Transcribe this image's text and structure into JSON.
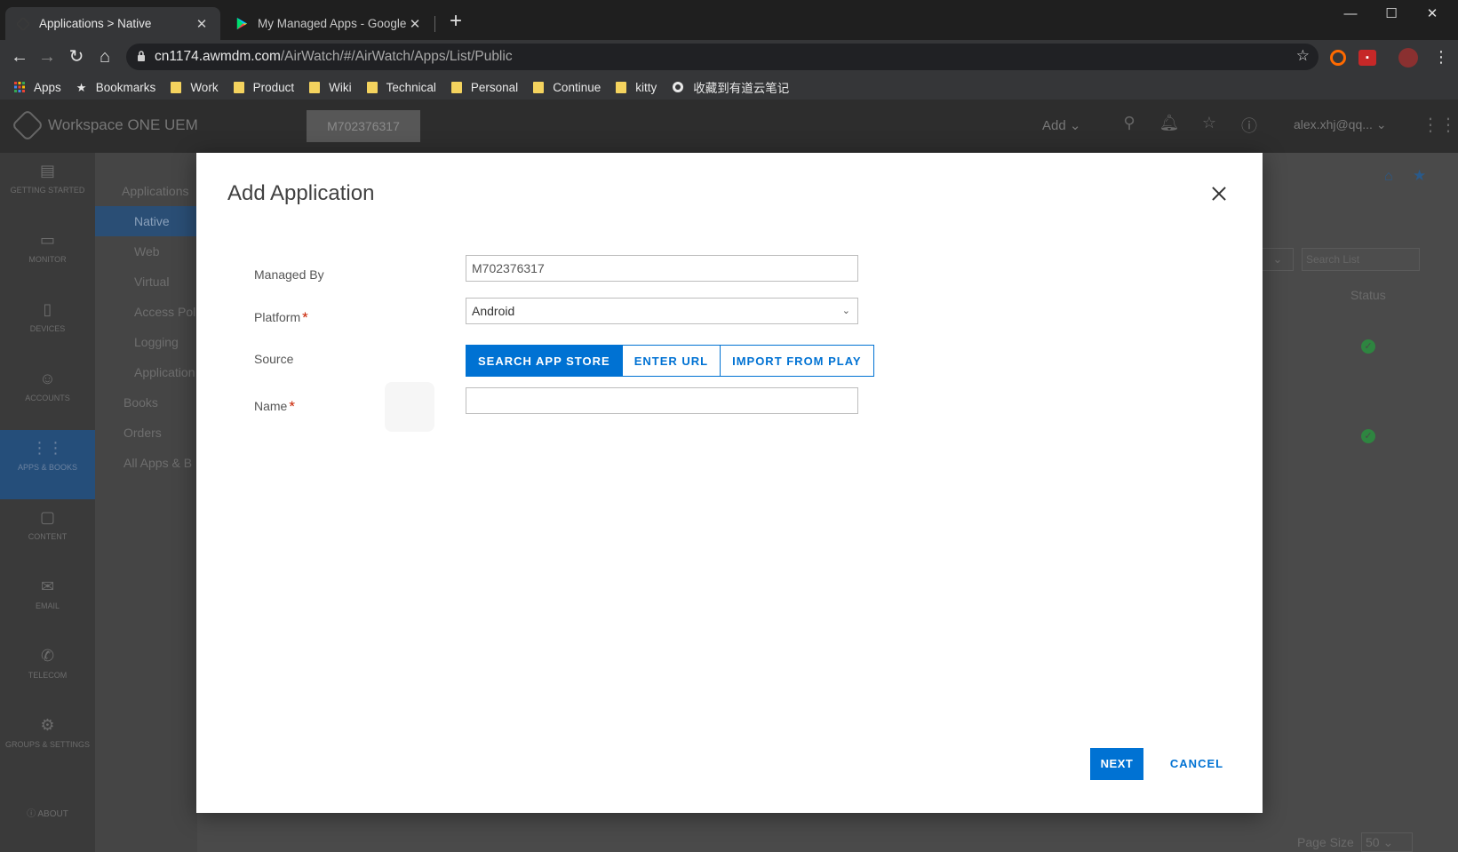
{
  "browser": {
    "tabs": [
      {
        "title": "Applications > Native",
        "active": true
      },
      {
        "title": "My Managed Apps - Google P",
        "active": false
      }
    ],
    "url_host": "cn1174.awmdm.com",
    "url_path": "/AirWatch/#/AirWatch/Apps/List/Public",
    "bookmarks": [
      {
        "label": "Apps",
        "icon": "apps-grid-icon"
      },
      {
        "label": "Bookmarks",
        "icon": "star-icon"
      },
      {
        "label": "Work",
        "icon": "folder-icon"
      },
      {
        "label": "Product",
        "icon": "folder-icon"
      },
      {
        "label": "Wiki",
        "icon": "folder-icon"
      },
      {
        "label": "Technical",
        "icon": "folder-icon"
      },
      {
        "label": "Personal",
        "icon": "folder-icon"
      },
      {
        "label": "Continue",
        "icon": "folder-icon"
      },
      {
        "label": "kitty",
        "icon": "folder-icon"
      },
      {
        "label": "收藏到有道云笔记",
        "icon": "globe-icon"
      }
    ]
  },
  "app": {
    "brand": "Workspace ONE UEM",
    "org": "M702376317",
    "add_label": "Add",
    "user": "alex.xhj@qq...",
    "leftnav": [
      {
        "label": "GETTING STARTED"
      },
      {
        "label": "MONITOR"
      },
      {
        "label": "DEVICES"
      },
      {
        "label": "ACCOUNTS"
      },
      {
        "label": "APPS & BOOKS"
      },
      {
        "label": "CONTENT"
      },
      {
        "label": "EMAIL"
      },
      {
        "label": "TELECOM"
      },
      {
        "label": "GROUPS & SETTINGS"
      }
    ],
    "about": "ABOUT",
    "subnav": [
      "Applications",
      "Native",
      "Web",
      "Virtual",
      "Access Pol",
      "Logging",
      "Application",
      "Books",
      "Orders",
      "All Apps & B"
    ],
    "right": {
      "search_placeholder": "Search List",
      "status_header": "Status",
      "page_size_label": "Page Size",
      "page_size_value": "50"
    }
  },
  "modal": {
    "title": "Add Application",
    "managed_by_label": "Managed By",
    "managed_by_value": "M702376317",
    "platform_label": "Platform",
    "platform_value": "Android",
    "source_label": "Source",
    "source_options": [
      "SEARCH APP STORE",
      "ENTER URL",
      "IMPORT FROM PLAY"
    ],
    "source_selected": "SEARCH APP STORE",
    "name_label": "Name",
    "name_value": "",
    "required_marker": "*",
    "next_label": "NEXT",
    "cancel_label": "CANCEL"
  },
  "colors": {
    "primary": "#0072d3",
    "required": "#c92100",
    "status_ok": "#2e8540"
  }
}
